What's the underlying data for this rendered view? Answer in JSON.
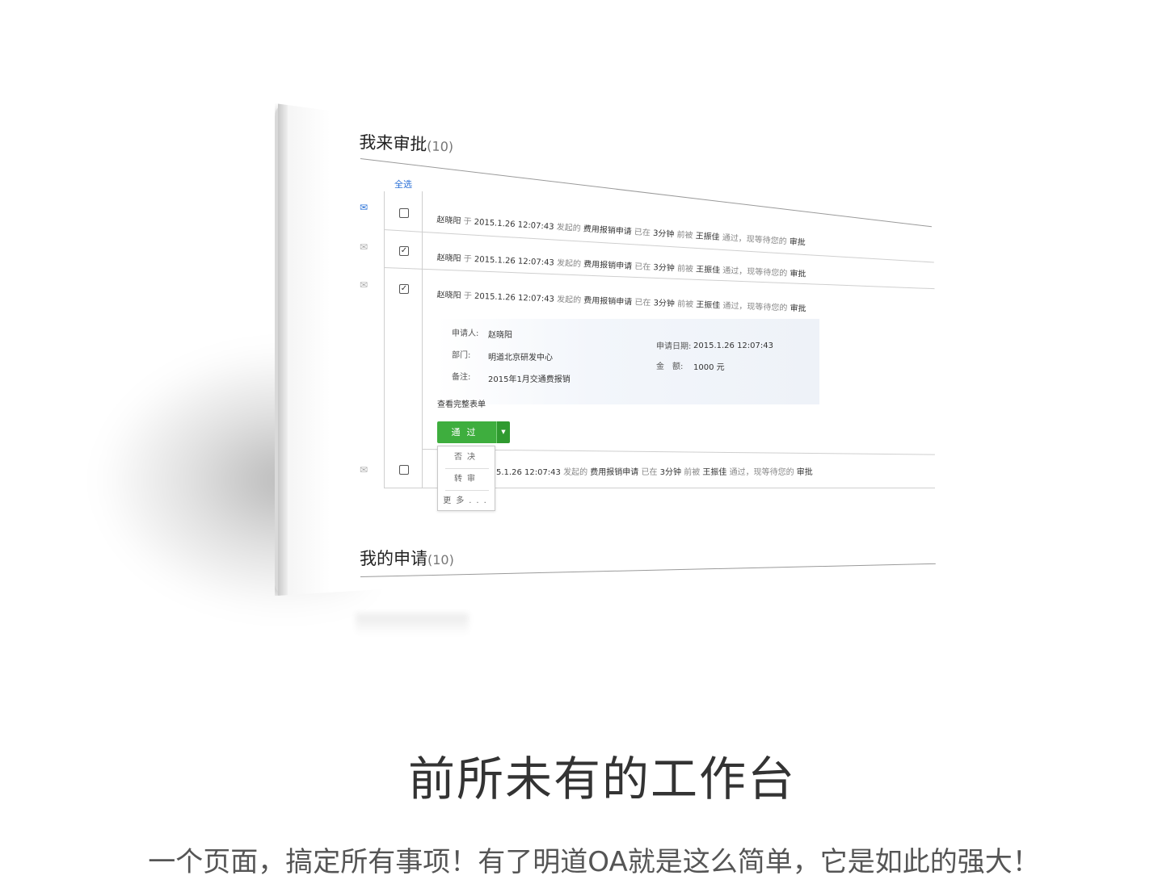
{
  "approve": {
    "title": "我来审批",
    "count": "(10)",
    "select_all": "全选",
    "rows": [
      {
        "name": "赵晓阳",
        "yu": "于",
        "time": "2015.1.26 12:07:43",
        "faqi": "发起的",
        "type": "费用报销申请",
        "yizai": "已在",
        "ago": "3分钟",
        "qianbei": "前被",
        "approver": "王振佳",
        "status": "通过，现等待您的",
        "action": "审批",
        "checked": false,
        "unread": true
      },
      {
        "name": "赵晓阳",
        "yu": "于",
        "time": "2015.1.26 12:07:43",
        "faqi": "发起的",
        "type": "费用报销申请",
        "yizai": "已在",
        "ago": "3分钟",
        "qianbei": "前被",
        "approver": "王振佳",
        "status": "通过，现等待您的",
        "action": "审批",
        "checked": true,
        "unread": false
      },
      {
        "name": "赵晓阳",
        "yu": "于",
        "time": "2015.1.26 12:07:43",
        "faqi": "发起的",
        "type": "费用报销申请",
        "yizai": "已在",
        "ago": "3分钟",
        "qianbei": "前被",
        "approver": "王振佳",
        "status": "通过，现等待您的",
        "action": "审批",
        "checked": true,
        "unread": false
      },
      {
        "name": "",
        "yu": "",
        "time": "5.1.26 12:07:43",
        "faqi": "发起的",
        "type": "费用报销申请",
        "yizai": "已在",
        "ago": "3分钟",
        "qianbei": "前被",
        "approver": "王振佳",
        "status": "通过，现等待您的",
        "action": "审批",
        "checked": false,
        "unread": false
      }
    ],
    "detail": {
      "applicant_label": "申请人:",
      "applicant": "赵晓阳",
      "dept_label": "部门:",
      "dept": "明道北京研发中心",
      "note_label": "备注:",
      "note": "2015年1月交通费报销",
      "date_label": "申请日期:",
      "date": "2015.1.26 12:07:43",
      "amount_label": "金　额:",
      "amount": "1000 元"
    },
    "full_form": "查看完整表单",
    "pass_button": "通过",
    "menu": [
      "否决",
      "转审",
      "更多..."
    ]
  },
  "mine": {
    "title": "我的申请",
    "count": "(10)"
  },
  "headline": "前所未有的工作台",
  "tagline": "一个页面，搞定所有事项！有了明道OA就是这么简单，它是如此的强大！"
}
